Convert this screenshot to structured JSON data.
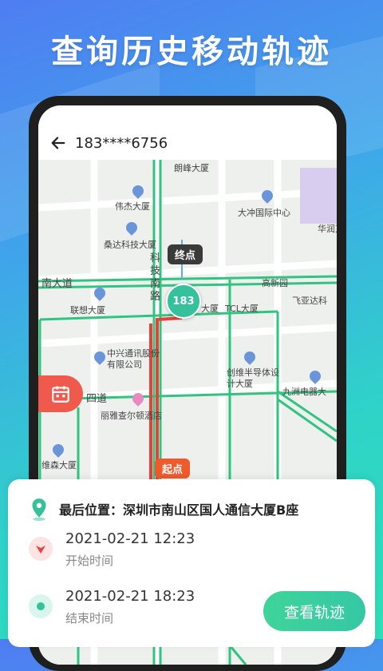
{
  "banner": {
    "title": "查询历史移动轨迹"
  },
  "header": {
    "phone": "183****6756"
  },
  "map": {
    "labels": {
      "l1": "朗峰大厦",
      "l2": "伟杰大厦",
      "l3": "大冲国际中心",
      "l4": "华润万",
      "l5": "桑达科技大厦",
      "l6": "南大道",
      "l7": "科技南路",
      "l8": "高新园",
      "l9": "飞亚达科",
      "l10": "联想大厦",
      "l11": "大厦",
      "l12": "TCL大厦",
      "l13": "中兴通讯股份有限公司",
      "l14": "创维半导体设计大厦",
      "l15": "九洲电器大",
      "l16": "四道",
      "l17": "丽雅查尔顿酒店",
      "l18": "维森大厦"
    },
    "marker_end": "终点",
    "marker_start": "起点",
    "marker_user": "183"
  },
  "info": {
    "location_label": "最后位置：深圳市南山区国人通信大厦B座",
    "start_time": "2021-02-21    12:23",
    "start_caption": "开始时间",
    "end_time": "2021-02-21    18:23",
    "end_caption": "结束时间",
    "track_button": "查看轨迹"
  },
  "colors": {
    "accent_green": "#35c29a",
    "route_red": "#ef5a2c",
    "calendar_red": "#ef5a4c"
  }
}
